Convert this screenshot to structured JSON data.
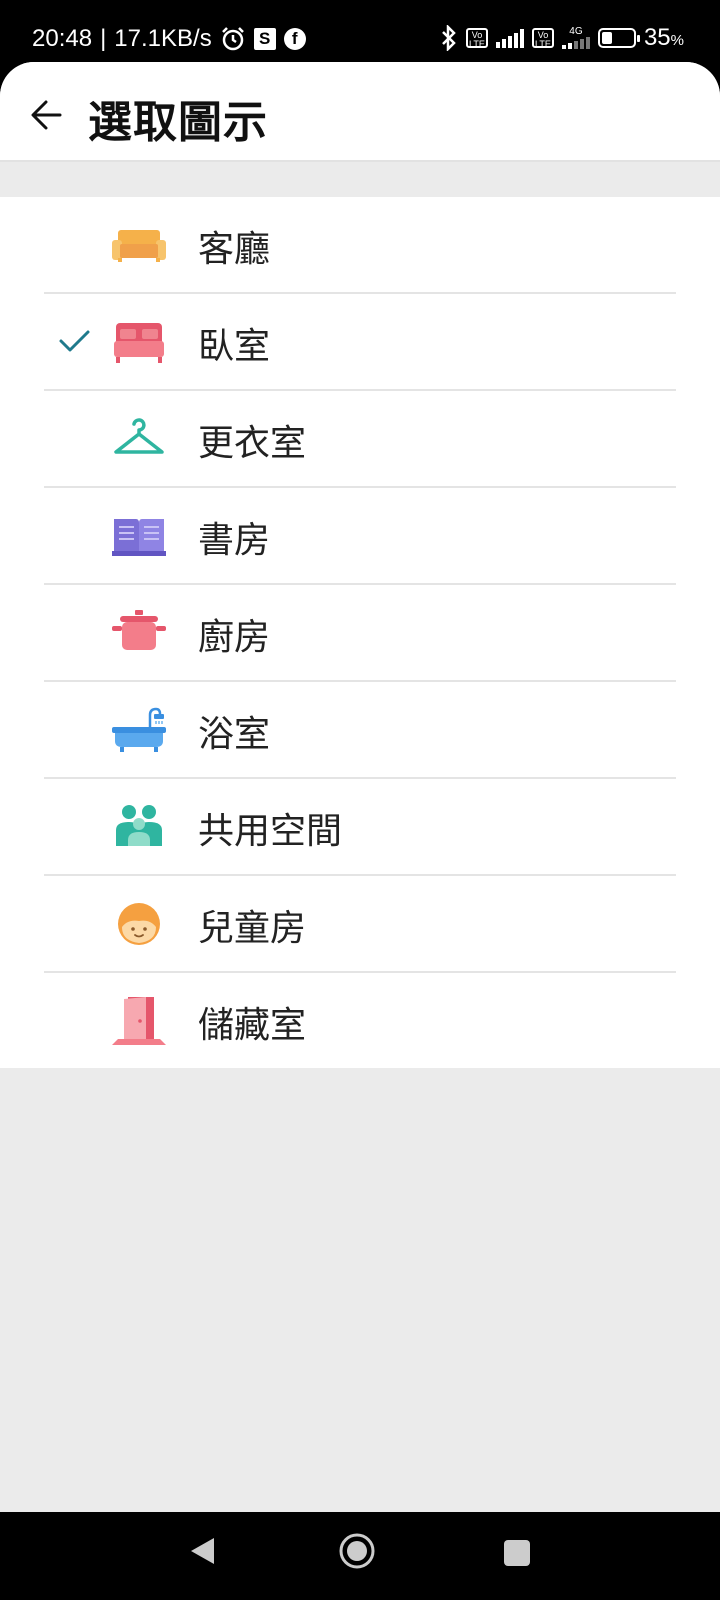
{
  "status_bar": {
    "time": "20:48",
    "separator": "|",
    "net_speed": "17.1KB/s",
    "icons": [
      "alarm-icon",
      "s-app-icon",
      "facebook-icon",
      "bluetooth-icon",
      "volte-icon",
      "signal-icon",
      "volte-icon",
      "4g-signal-icon",
      "battery-icon"
    ],
    "s_label": "S",
    "fb_label": "f",
    "volte_label": "Vo LTE",
    "net_type": "4G",
    "battery_pct": "35",
    "battery_unit": "%"
  },
  "header": {
    "title": "選取圖示",
    "back_icon": "arrow-left-icon"
  },
  "rooms": [
    {
      "label": "客廳",
      "icon": "sofa-icon",
      "selected": false
    },
    {
      "label": "臥室",
      "icon": "bed-icon",
      "selected": true
    },
    {
      "label": "更衣室",
      "icon": "hanger-icon",
      "selected": false
    },
    {
      "label": "書房",
      "icon": "book-icon",
      "selected": false
    },
    {
      "label": "廚房",
      "icon": "pot-icon",
      "selected": false
    },
    {
      "label": "浴室",
      "icon": "bathtub-icon",
      "selected": false
    },
    {
      "label": "共用空間",
      "icon": "people-icon",
      "selected": false
    },
    {
      "label": "兒童房",
      "icon": "child-face-icon",
      "selected": false
    },
    {
      "label": "儲藏室",
      "icon": "door-icon",
      "selected": false
    }
  ],
  "colors": {
    "accent_check": "#1f7a8c",
    "background": "#ebebeb"
  }
}
